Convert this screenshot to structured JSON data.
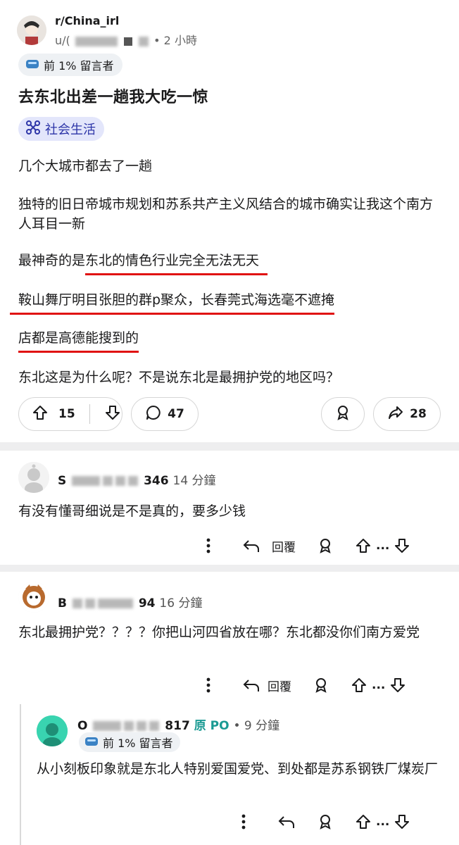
{
  "post": {
    "subreddit": "r/China_irl",
    "user_prefix": "u/(",
    "time": "• 2 小時",
    "flair": "前 1% 留言者",
    "title": "去东北出差一趟我大吃一惊",
    "tag": "社会生活",
    "paragraphs": [
      "几个大城市都去了一趟",
      "独特的旧日帝城市规划和苏系共产主义风结合的城市确实让我这个南方人耳目一新",
      "东北这是为什么呢？不是说东北是最拥护党的地区吗？"
    ],
    "p3_prefix": "最神奇的是",
    "p3_underlined": "东北的情色行业完全无法无天",
    "p4_underlined": "鞍山舞厅明目张胆的群p聚众，长春莞式海选毫不遮掩",
    "p5_underlined": "店都是高德能搜到的",
    "upvotes": "15",
    "comments": "47",
    "shares": "28"
  },
  "comments": [
    {
      "user_start": "S",
      "user_end": "346",
      "time": "14 分鐘",
      "text": "有没有懂哥细说是不是真的，要多少钱",
      "reply_label": "回覆"
    },
    {
      "user_start": "B",
      "user_end": "94",
      "time": "16 分鐘",
      "text": "东北最拥护党？？？？你把山河四省放在哪？东北都没你们南方爱党",
      "reply_label": "回覆"
    },
    {
      "user_start": "O",
      "user_end": "817",
      "op_label": "原 PO",
      "time": "• 9 分鐘",
      "flair": "前 1% 留言者",
      "text": "从小刻板印象就是东北人特别爱国爱党、到处都是苏系钢铁厂煤炭厂"
    }
  ],
  "more_dots": "...",
  "colors": {
    "accent_red": "#e01212",
    "tag_bg": "#e3e6fb",
    "tag_text": "#2d35a8",
    "op_teal": "#1a9a93"
  }
}
